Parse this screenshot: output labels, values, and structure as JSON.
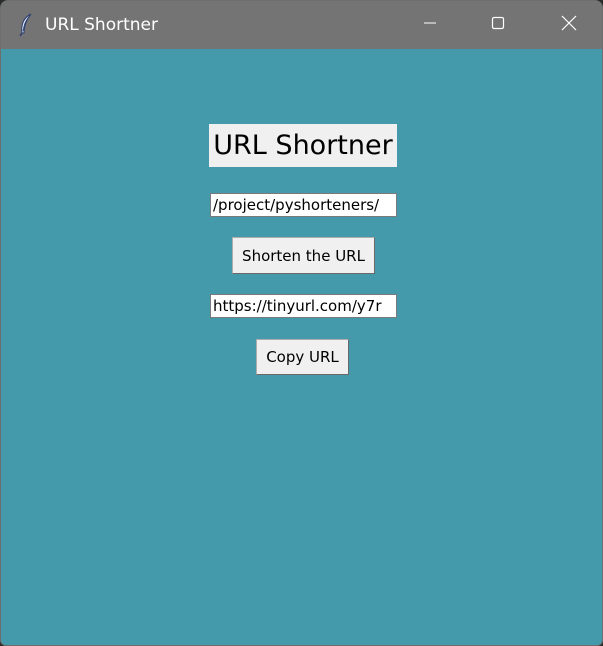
{
  "window": {
    "title": "URL Shortner",
    "icon": "feather-icon",
    "controls": [
      "minimize-icon",
      "maximize-icon",
      "close-icon"
    ]
  },
  "app": {
    "heading": "URL Shortner",
    "url_input_value": "/project/pyshorteners/",
    "shorten_button_label": "Shorten the URL",
    "short_url_value": "https://tinyurl.com/y7r",
    "copy_button_label": "Copy URL"
  },
  "colors": {
    "background": "#4499aa",
    "titlebar": "#747474",
    "widget": "#f0f0f0"
  }
}
